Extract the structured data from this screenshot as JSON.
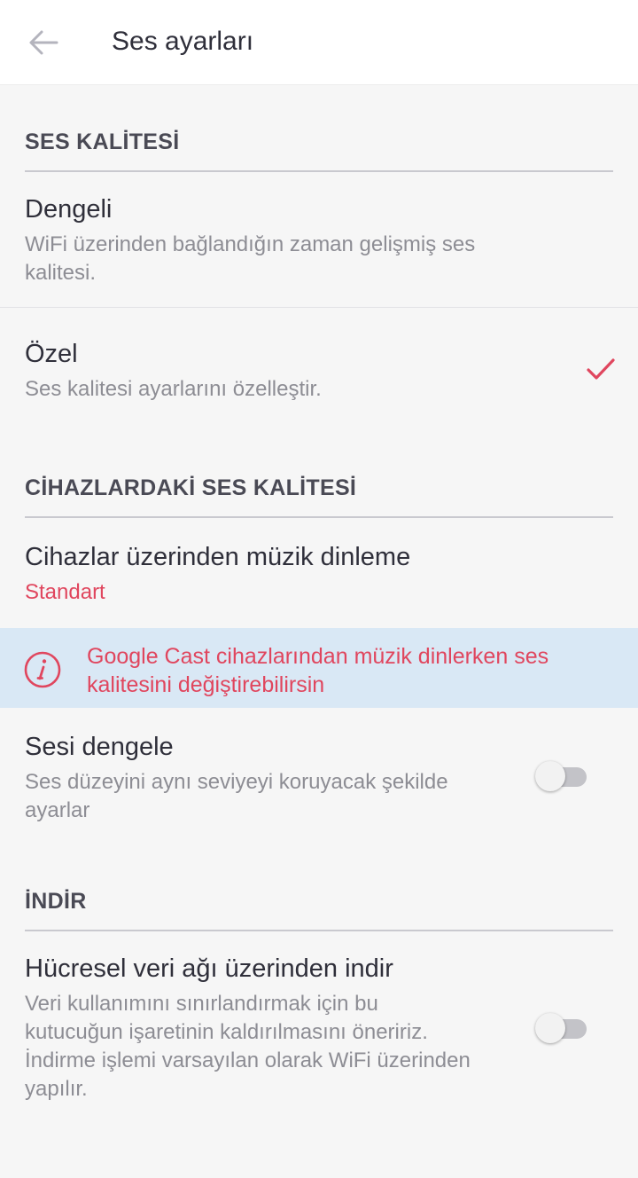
{
  "appbar": {
    "title": "Ses ayarları",
    "back_icon": "arrow-left-icon"
  },
  "sections": {
    "quality": {
      "header": "SES KALİTESİ",
      "options": [
        {
          "title": "Dengeli",
          "subtitle_line1": "WiFi üzerinden bağlandığın zaman gelişmiş ses",
          "subtitle_line2": "kalitesi.",
          "selected": false
        },
        {
          "title": "Özel",
          "subtitle_line1": "Ses kalitesi ayarlarını özelleştir.",
          "selected": true
        }
      ]
    },
    "device_quality": {
      "header": "CİHAZLARDAKİ SES KALİTESİ",
      "listen": {
        "title": "Cihazlar üzerinden müzik dinleme",
        "value": "Standart"
      },
      "info": {
        "line1": "Google Cast cihazlarından müzik dinlerken ses",
        "line2": "kalitesini değiştirebilirsin",
        "icon": "info-circle-icon"
      },
      "normalize": {
        "title": "Sesi dengele",
        "subtitle_line1": "Ses düzeyini aynı seviyeyi koruyacak şekilde",
        "subtitle_line2": "ayarlar",
        "enabled": false
      }
    },
    "download": {
      "header": "İNDİR",
      "cellular": {
        "title": "Hücresel veri ağı üzerinden indir",
        "subtitle_line1": "Veri kullanımını sınırlandırmak için bu",
        "subtitle_line2": "kutucuğun işaretinin kaldırılmasını öneririz.",
        "subtitle_line3": "İndirme işlemi varsayılan olarak WiFi üzerinden",
        "subtitle_line4": "yapılır.",
        "enabled": false
      }
    }
  },
  "colors": {
    "accent": "#e0465e",
    "info_bg": "#d9e8f5",
    "background": "#f6f6f6"
  }
}
